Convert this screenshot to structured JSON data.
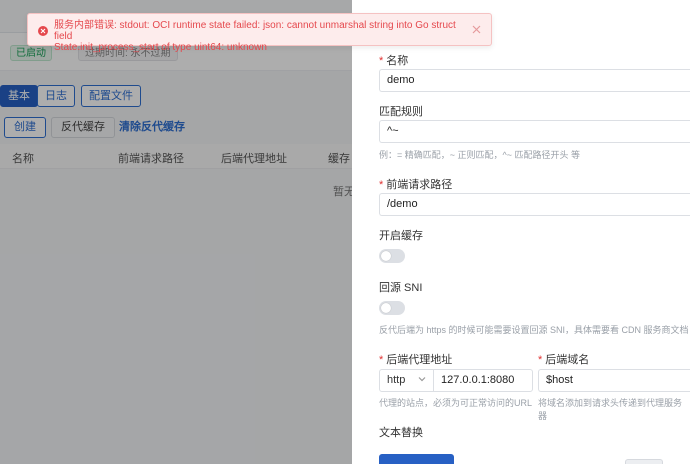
{
  "background": {
    "status_badge": "已启动",
    "expiry_badge": "过期时间: 永不过期",
    "tabs": [
      {
        "label": "基本",
        "active": true
      },
      {
        "label": "日志",
        "active": false
      },
      {
        "label": "配置文件",
        "active": false
      }
    ],
    "toolbar": {
      "create_label": "创建",
      "proxy_cache_label": "反代缓存",
      "clear_cache_label": "清除反代缓存"
    },
    "table": {
      "columns": [
        "名称",
        "前端请求路径",
        "后端代理地址",
        "缓存"
      ],
      "empty_text": "暂无"
    }
  },
  "drawer": {
    "name": {
      "label": "名称",
      "required": true,
      "value": "demo"
    },
    "match_rule": {
      "label": "匹配规则",
      "required": false,
      "value": "^~",
      "hint": "例：= 精确匹配，~ 正则匹配，^~ 匹配路径开头 等"
    },
    "frontend_path": {
      "label": "前端请求路径",
      "required": true,
      "value": "/demo"
    },
    "enable_cache": {
      "label": "开启缓存",
      "on": false
    },
    "origin_sni": {
      "label": "回源 SNI",
      "on": false,
      "hint": "反代后端为 https 的时候可能需要设置回源 SNI，具体需要看 CDN 服务商文档"
    },
    "backend_address": {
      "label": "后端代理地址",
      "required": true,
      "protocol": "http",
      "value": "127.0.0.1:8080",
      "hint": "代理的站点，必须为可正常访问的URL"
    },
    "backend_host": {
      "label": "后端域名",
      "required": true,
      "value": "$host",
      "hint": "将域名添加到请求头传递到代理服务器"
    },
    "text_replace": {
      "label": "文本替换"
    }
  },
  "toast": {
    "type": "error",
    "message_line1": "服务内部错误: stdout: OCI runtime state failed: json: cannot unmarshal string into Go struct field",
    "message_line2": "State.init_process_start of type uint64: unknown",
    "icon": "error-circle-icon",
    "close_icon": "close-icon"
  },
  "colors": {
    "primary": "#2760c4",
    "error": "#e5484d",
    "success": "#18a058"
  }
}
